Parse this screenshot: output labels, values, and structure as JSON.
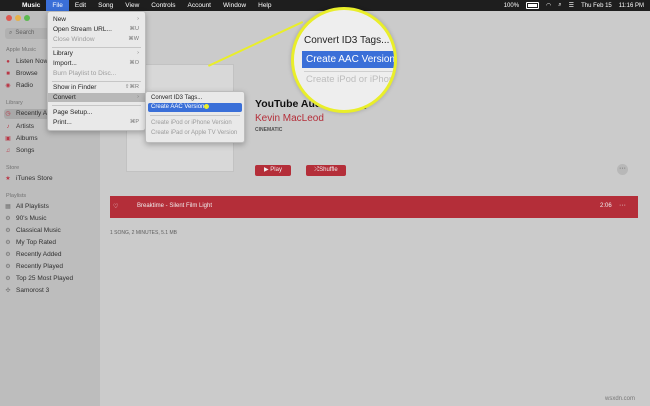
{
  "menubar": {
    "apple_icon": "apple-icon",
    "items": [
      "Music",
      "File",
      "Edit",
      "Song",
      "View",
      "Controls",
      "Account",
      "Window",
      "Help"
    ],
    "battery": "100%",
    "date": "Thu Feb 15",
    "time": "11:16 PM"
  },
  "sidebar": {
    "search_placeholder": "Search",
    "sections": {
      "apple_music": "Apple Music",
      "library": "Library",
      "store": "Store",
      "playlists": "Playlists"
    },
    "apple_music_items": [
      "Listen Now",
      "Browse",
      "Radio"
    ],
    "library_items": [
      "Recently Added",
      "Artists",
      "Albums",
      "Songs"
    ],
    "store_items": [
      "iTunes Store"
    ],
    "playlist_items": [
      "All Playlists",
      "90's Music",
      "Classical Music",
      "My Top Rated",
      "Recently Added",
      "Recently Played",
      "Top 25 Most Played",
      "Samorost 3"
    ]
  },
  "album": {
    "title": "YouTube Audio Library",
    "artist": "Kevin MacLeod",
    "genre": "CINEMATIC",
    "play_label": "Play",
    "shuffle_label": "Shuffle",
    "summary": "1 SONG, 2 MINUTES, 5.1 MB"
  },
  "track": {
    "name": "Breaktime - Silent Film Light",
    "duration": "2:06"
  },
  "file_menu": {
    "items": [
      {
        "label": "New",
        "shortcut": "›"
      },
      {
        "label": "Open Stream URL...",
        "shortcut": "⌘U"
      },
      {
        "label": "Close Window",
        "shortcut": "⌘W"
      },
      {
        "label": "Library",
        "shortcut": "›"
      },
      {
        "label": "Import...",
        "shortcut": "⌘O"
      },
      {
        "label": "Burn Playlist to Disc...",
        "shortcut": ""
      },
      {
        "label": "Show in Finder",
        "shortcut": "⇧⌘R"
      },
      {
        "label": "Convert",
        "shortcut": "›"
      },
      {
        "label": "Page Setup...",
        "shortcut": ""
      },
      {
        "label": "Print...",
        "shortcut": "⌘P"
      }
    ]
  },
  "convert_menu": {
    "items": [
      "Convert ID3 Tags...",
      "Create AAC Version",
      "Create iPod or iPhone Version",
      "Create iPad or Apple TV Version"
    ]
  },
  "zoom": {
    "line1": "Convert ID3 Tags...",
    "line2": "Create AAC Version",
    "line3": "Create iPod or iPhone Version"
  },
  "watermark": "wsxdn.com",
  "colors": {
    "accent": "#c0313d",
    "highlight": "#3a6fd8",
    "callout": "#e9ee2a"
  }
}
